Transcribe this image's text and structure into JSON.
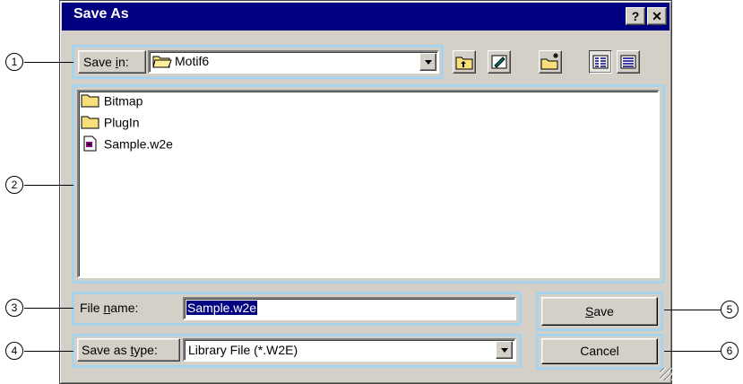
{
  "window": {
    "title": "Save As",
    "help_label": "?",
    "close_label": "✕"
  },
  "save_in": {
    "label_prefix": "Save ",
    "label_mnemonic": "i",
    "label_suffix": "n:",
    "value": "Motif6"
  },
  "toolbar": {
    "icons": [
      "up-one-level-icon",
      "desktop-icon",
      "new-folder-icon",
      "list-view-icon",
      "details-view-icon"
    ]
  },
  "files": [
    {
      "name": "Bitmap",
      "icon": "folder-icon"
    },
    {
      "name": "PlugIn",
      "icon": "folder-icon"
    },
    {
      "name": "Sample.w2e",
      "icon": "document-icon"
    }
  ],
  "file_name": {
    "label_prefix": "File ",
    "label_mnemonic": "n",
    "label_suffix": "ame:",
    "value": "Sample.w2e"
  },
  "save_as_type": {
    "label_prefix": "Save as ",
    "label_mnemonic": "t",
    "label_suffix": "ype:",
    "value": "Library File (*.W2E)"
  },
  "buttons": {
    "save_mnemonic": "S",
    "save_rest": "ave",
    "cancel": "Cancel"
  },
  "callouts": [
    "1",
    "2",
    "3",
    "4",
    "5",
    "6"
  ],
  "colors": {
    "titlebar": "#000080",
    "face": "#d4d0c8",
    "highlight_box": "#a8d3ec",
    "selection": "#000080"
  }
}
